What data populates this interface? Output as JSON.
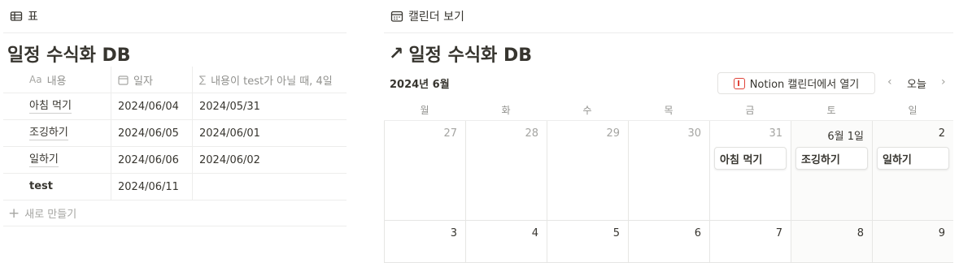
{
  "left": {
    "view_tab_label": "표",
    "title": "일정 수식화 DB",
    "columns": [
      "내용",
      "일자",
      "내용이 test가 아닐 때, 4일"
    ],
    "column_icon_text": [
      "Aa",
      "",
      "∑"
    ],
    "rows": [
      {
        "name": "아침 먹기",
        "date": "2024/06/04",
        "formula": "2024/05/31",
        "bold": false
      },
      {
        "name": "조깅하기",
        "date": "2024/06/05",
        "formula": "2024/06/01",
        "bold": false
      },
      {
        "name": "일하기",
        "date": "2024/06/06",
        "formula": "2024/06/02",
        "bold": false
      },
      {
        "name": "test",
        "date": "2024/06/11",
        "formula": "",
        "bold": true
      }
    ],
    "new_row_label": "새로 만들기"
  },
  "right": {
    "view_tab_label": "캘린더 보기",
    "title": "일정 수식화 DB",
    "title_arrow": "↗",
    "month_label": "2024년 6월",
    "open_button_label": "Notion 캘린더에서 열기",
    "today_label": "오늘",
    "prev": "‹",
    "next": "›",
    "weekdays": [
      "월",
      "화",
      "수",
      "목",
      "금",
      "토",
      "일"
    ],
    "weeks": [
      [
        {
          "label": "27",
          "muted": true,
          "event": ""
        },
        {
          "label": "28",
          "muted": true,
          "event": ""
        },
        {
          "label": "29",
          "muted": true,
          "event": ""
        },
        {
          "label": "30",
          "muted": true,
          "event": ""
        },
        {
          "label": "31",
          "muted": true,
          "event": "아침 먹기"
        },
        {
          "label": "6월 1일",
          "muted": false,
          "event": "조깅하기"
        },
        {
          "label": "2",
          "muted": false,
          "event": "일하기"
        }
      ],
      [
        {
          "label": "3",
          "muted": false,
          "event": ""
        },
        {
          "label": "4",
          "muted": false,
          "event": ""
        },
        {
          "label": "5",
          "muted": false,
          "event": ""
        },
        {
          "label": "6",
          "muted": false,
          "event": ""
        },
        {
          "label": "7",
          "muted": false,
          "event": ""
        },
        {
          "label": "8",
          "muted": false,
          "event": ""
        },
        {
          "label": "9",
          "muted": false,
          "event": ""
        }
      ]
    ]
  }
}
